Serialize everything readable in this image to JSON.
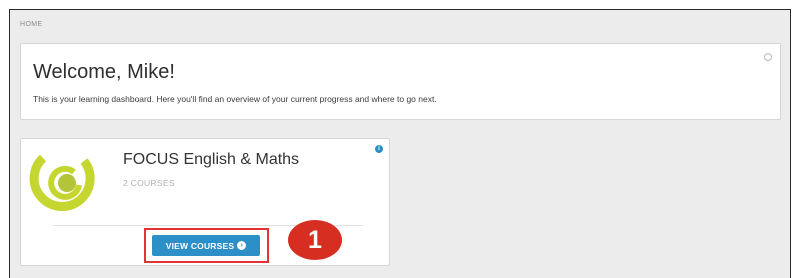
{
  "breadcrumb": {
    "label": "HOME"
  },
  "welcome": {
    "title": "Welcome, Mike!",
    "text": "This is your learning dashboard. Here you'll find an overview of your current progress and where to go next."
  },
  "course_card": {
    "title": "FOCUS English & Maths",
    "count": "2 COURSES",
    "button_label": "VIEW COURSES",
    "info_glyph": "i"
  },
  "annotation": {
    "step_number": "1"
  },
  "icons": {
    "settings": "settings-circle-icon",
    "info": "info-icon",
    "button_arrow": "arrow-circle-right-icon",
    "logo": "course-logo-rings"
  },
  "colors": {
    "accent_blue": "#2d8fc8",
    "logo_green": "#c6d630",
    "highlight_red": "#e23434",
    "badge_red": "#d62f22"
  }
}
